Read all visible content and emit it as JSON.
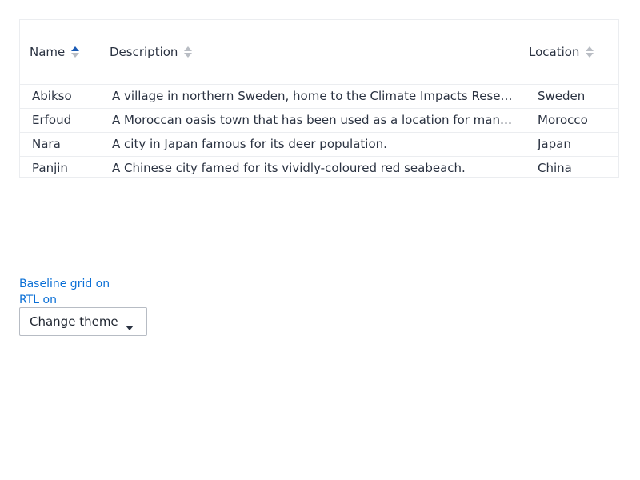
{
  "table": {
    "columns": [
      {
        "label": "Name",
        "sort": "ascending"
      },
      {
        "label": "Description",
        "sort": "none"
      },
      {
        "label": "Location",
        "sort": "none"
      }
    ],
    "rows": [
      {
        "name": "Abikso",
        "description": "A village in northern Sweden, home to the Climate Impacts Research Ce...",
        "location": "Sweden"
      },
      {
        "name": "Erfoud",
        "description": "A Moroccan oasis town that has been used as a location for many films.",
        "location": "Morocco"
      },
      {
        "name": "Nara",
        "description": "A city in Japan famous for its deer population.",
        "location": "Japan"
      },
      {
        "name": "Panjin",
        "description": "A Chinese city famed for its vividly-coloured red seabeach.",
        "location": "China"
      }
    ]
  },
  "toggles": {
    "baseline_grid": "Baseline grid on",
    "rtl": "RTL on"
  },
  "theme_select": {
    "label": "Change theme"
  },
  "colors": {
    "accent": "#0a6fd6",
    "sort_active": "#1a5bb5",
    "sort_inactive": "#b9bdc4",
    "border": "#ebedf0",
    "text": "#2a3241"
  }
}
